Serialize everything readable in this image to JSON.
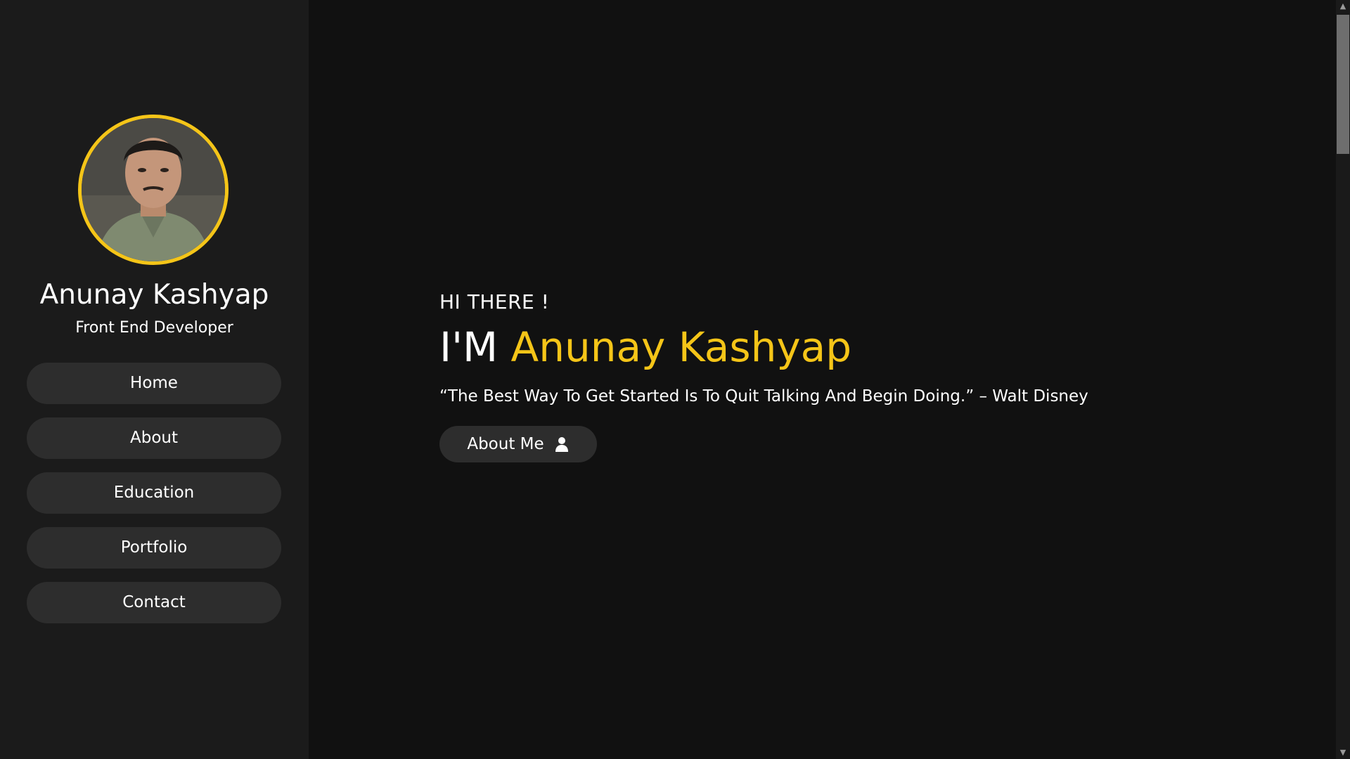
{
  "profile": {
    "name": "Anunay Kashyap",
    "role": "Front End Developer",
    "avatar_icon": "profile-photo"
  },
  "nav": {
    "items": [
      {
        "label": "Home"
      },
      {
        "label": "About"
      },
      {
        "label": "Education"
      },
      {
        "label": "Portfolio"
      },
      {
        "label": "Contact"
      }
    ]
  },
  "hero": {
    "greeting": "HI THERE !",
    "title_prefix": "I'M",
    "title_name": "Anunay Kashyap",
    "quote": "“The Best Way To Get Started Is To Quit Talking And Begin Doing.” – Walt Disney",
    "button_label": "About Me",
    "button_icon": "user-icon"
  },
  "colors": {
    "accent": "#f5c518",
    "sidebar_bg": "#1b1b1b",
    "main_bg": "#111111",
    "button_bg": "#2d2d2d"
  }
}
